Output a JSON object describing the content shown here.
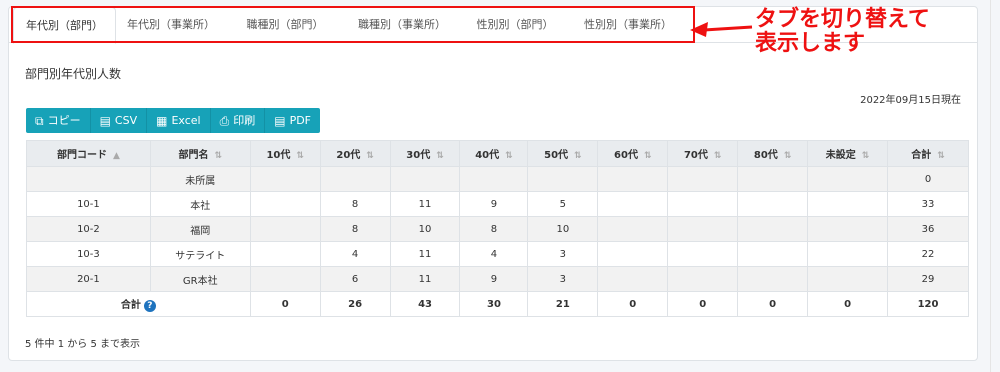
{
  "tabs": [
    {
      "label": "年代別（部門）",
      "active": true
    },
    {
      "label": "年代別（事業所）",
      "active": false
    },
    {
      "label": "職種別（部門）",
      "active": false
    },
    {
      "label": "職種別（事業所）",
      "active": false
    },
    {
      "label": "性別別（部門）",
      "active": false
    },
    {
      "label": "性別別（事業所）",
      "active": false
    }
  ],
  "annotation": {
    "line1": "タブを切り替えて",
    "line2": "表示します",
    "color": "#ee1111"
  },
  "section_title": "部門別年代別人数",
  "as_of": "2022年09月15日現在",
  "buttons": [
    {
      "label": "コピー",
      "icon": "copy-icon"
    },
    {
      "label": "CSV",
      "icon": "file-icon"
    },
    {
      "label": "Excel",
      "icon": "excel-icon"
    },
    {
      "label": "印刷",
      "icon": "print-icon"
    },
    {
      "label": "PDF",
      "icon": "pdf-icon"
    }
  ],
  "table": {
    "headers": [
      "部門コード",
      "部門名",
      "10代",
      "20代",
      "30代",
      "40代",
      "50代",
      "60代",
      "70代",
      "80代",
      "未設定",
      "合計"
    ],
    "rows": [
      [
        "",
        "未所属",
        "",
        "",
        "",
        "",
        "",
        "",
        "",
        "",
        "",
        "0"
      ],
      [
        "10-1",
        "本社",
        "",
        "8",
        "11",
        "9",
        "5",
        "",
        "",
        "",
        "",
        "33"
      ],
      [
        "10-2",
        "福岡",
        "",
        "8",
        "10",
        "8",
        "10",
        "",
        "",
        "",
        "",
        "36"
      ],
      [
        "10-3",
        "サテライト",
        "",
        "4",
        "11",
        "4",
        "3",
        "",
        "",
        "",
        "",
        "22"
      ],
      [
        "20-1",
        "GR本社",
        "",
        "6",
        "11",
        "9",
        "3",
        "",
        "",
        "",
        "",
        "29"
      ]
    ],
    "total_label": "合計",
    "totals": [
      "0",
      "26",
      "43",
      "30",
      "21",
      "0",
      "0",
      "0",
      "0",
      "120"
    ]
  },
  "footer_text": "5 件中 1 から 5 まで表示",
  "colors": {
    "accent": "#17a2b8",
    "highlight": "#ee1111"
  }
}
